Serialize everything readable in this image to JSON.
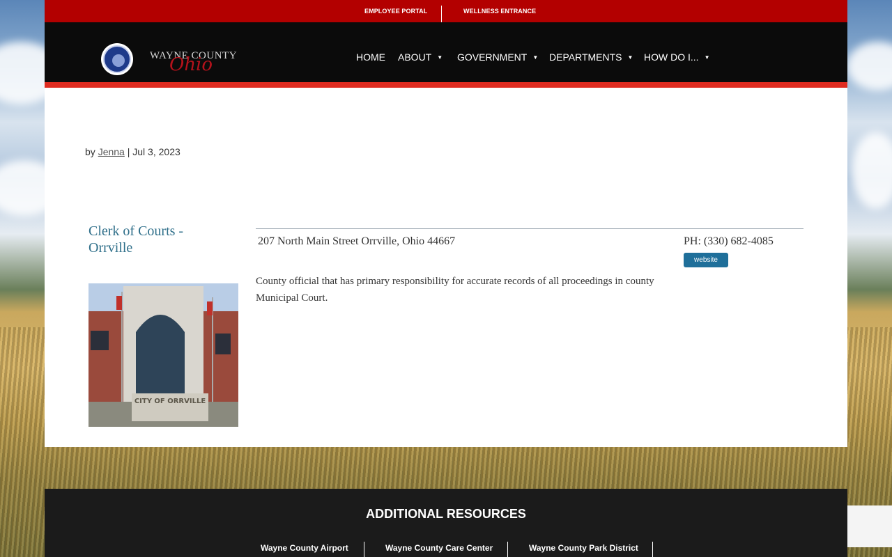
{
  "topbar": {
    "employee_portal": "EMPLOYEE PORTAL",
    "wellness_entrance": "WELLNESS ENTRANCE"
  },
  "brand": {
    "logo_top": "WAYNE COUNTY",
    "logo_script": "Ohio"
  },
  "nav": {
    "items": [
      {
        "label": "HOME"
      },
      {
        "label": "ABOUT"
      },
      {
        "label": "GOVERNMENT"
      },
      {
        "label": "DEPARTMENTS"
      },
      {
        "label": "HOW DO I..."
      }
    ]
  },
  "post": {
    "by": "by",
    "author": "Jenna",
    "separator": "|",
    "date": "Jul 3, 2023"
  },
  "entry": {
    "title": "Clerk of Courts - Orrville",
    "image_sign": "CITY OF ORRVILLE",
    "address": "207 North Main Street  Orrville, Ohio 44667",
    "phone": "PH:  (330) 682-4085",
    "website_label": "website",
    "description": "County official that has primary responsibility for accurate records of all proceedings in county Municipal Court."
  },
  "footer": {
    "title": "ADDITIONAL RESOURCES",
    "links": [
      {
        "label": "Wayne County Airport"
      },
      {
        "label": "Wayne County Care Center"
      },
      {
        "label": "Wayne County Park District"
      }
    ]
  },
  "colors": {
    "topbar": "#b30000",
    "navbar": "#0b0b0b",
    "accent_line": "#e02b20",
    "title_blue": "#2f6f8a",
    "button_blue": "#1f6f9a",
    "footer": "#1b1b1b"
  }
}
